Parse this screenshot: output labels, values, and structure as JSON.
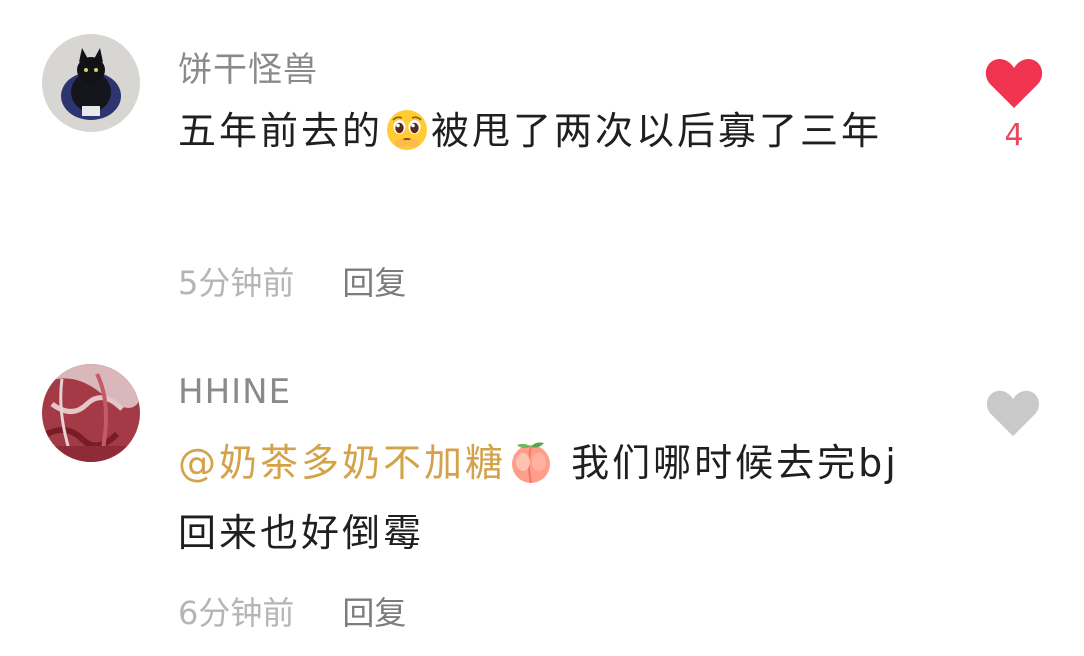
{
  "comments": [
    {
      "username": "饼干怪兽",
      "text_before": "五年前去的",
      "emoji": "pleading-face-emoji",
      "text_after": "被甩了两次以后寡了三年",
      "time": "5分钟前",
      "reply_label": "回复",
      "like_count": "4",
      "liked": true,
      "like_color": "#f0344f"
    },
    {
      "username": "HHINE",
      "mention": "@奶茶多奶不加糖",
      "emoji": "peach-emoji",
      "text_after": " 我们哪时候去完bj回来也好倒霉",
      "time": "6分钟前",
      "reply_label": "回复",
      "liked": false,
      "like_color": "#c9c9c9"
    }
  ],
  "colors": {
    "mention": "#d4a248",
    "username": "#8a8a8a",
    "time": "#b5b5b5",
    "reply": "#7c7c7c"
  }
}
